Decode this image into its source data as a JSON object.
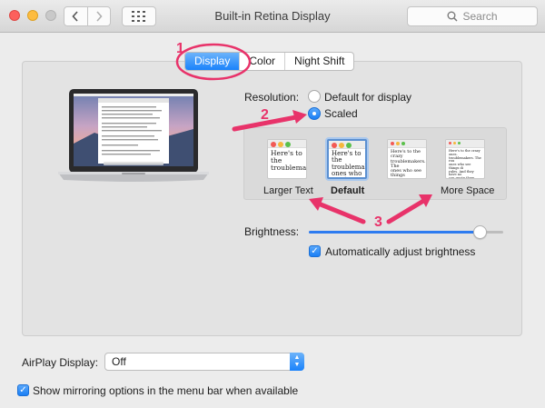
{
  "window": {
    "title": "Built-in Retina Display"
  },
  "search": {
    "placeholder": "Search"
  },
  "tabs": [
    {
      "label": "Display",
      "active": true
    },
    {
      "label": "Color",
      "active": false
    },
    {
      "label": "Night Shift",
      "active": false
    }
  ],
  "resolution": {
    "label": "Resolution:",
    "options": [
      {
        "label": "Default for display",
        "selected": false
      },
      {
        "label": "Scaled",
        "selected": true
      }
    ]
  },
  "scaled_options": [
    {
      "label": "Larger Text",
      "preview": "Here's to the\ntroublemakers",
      "selected": false,
      "bold": false
    },
    {
      "label": "Default",
      "preview": "Here's to the\ntroublemakers.\nones who see t\nrules. And they",
      "selected": true,
      "bold": true
    },
    {
      "label": "",
      "preview": "Here's to the crazy\ntroublemakers. The\nones who see things\nrules. And they hav",
      "selected": false,
      "bold": false
    },
    {
      "label": "More Space",
      "preview": "Here's to the crazy ones.\ntroublemakers. The rou\nones who see things di\nrules. And they have no\ncan quote them, disagre\nthem. About the only th\nBecause they change th",
      "selected": false,
      "bold": false
    }
  ],
  "brightness": {
    "label": "Brightness:",
    "level": 0.88,
    "auto_label": "Automatically adjust brightness",
    "auto_checked": true
  },
  "airplay": {
    "label": "AirPlay Display:",
    "value": "Off"
  },
  "mirroring": {
    "label": "Show mirroring options in the menu bar when available",
    "checked": true
  },
  "annotations": {
    "n1": "1",
    "n2": "2",
    "n3": "3",
    "color": "#e8336a"
  },
  "colors": {
    "accent": "#1a82fb",
    "annotation": "#e8336a"
  }
}
